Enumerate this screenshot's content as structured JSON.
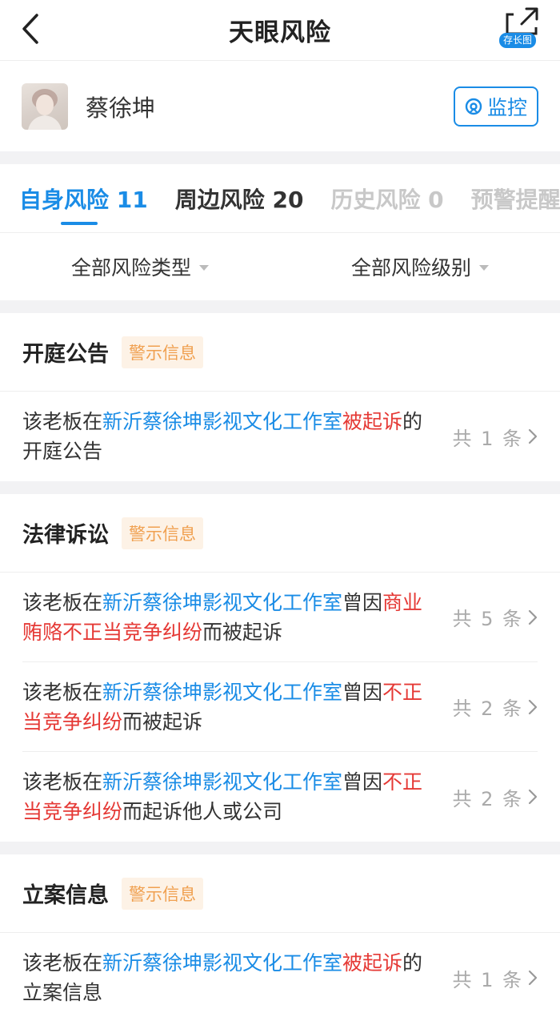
{
  "header": {
    "title": "天眼风险",
    "share_badge": "存长图"
  },
  "boss": {
    "name": "蔡徐坤",
    "monitor_label": "监控"
  },
  "tabs": [
    {
      "label": "自身风险 11"
    },
    {
      "label": "周边风险 20"
    },
    {
      "label": "历史风险 0"
    },
    {
      "label": "预警提醒"
    }
  ],
  "filters": {
    "type_label": "全部风险类型",
    "level_label": "全部风险级别"
  },
  "sections": [
    {
      "title": "开庭公告",
      "tag": "警示信息",
      "rows": [
        {
          "prefix": "该老板在",
          "company": "新沂蔡徐坤影视文化工作室",
          "mid": "",
          "highlight": "被起诉",
          "suffix": "的开庭公告",
          "count": "共 1 条"
        }
      ]
    },
    {
      "title": "法律诉讼",
      "tag": "警示信息",
      "rows": [
        {
          "prefix": "该老板在",
          "company": "新沂蔡徐坤影视文化工作室",
          "mid": "曾因",
          "highlight": "商业贿赂不正当竞争纠纷",
          "suffix": "而被起诉",
          "count": "共 5 条"
        },
        {
          "prefix": "该老板在",
          "company": "新沂蔡徐坤影视文化工作室",
          "mid": "曾因",
          "highlight": "不正当竞争纠纷",
          "suffix": "而被起诉",
          "count": "共 2 条"
        },
        {
          "prefix": "该老板在",
          "company": "新沂蔡徐坤影视文化工作室",
          "mid": "曾因",
          "highlight": "不正当竞争纠纷",
          "suffix": "而起诉他人或公司",
          "count": "共 2 条"
        }
      ]
    },
    {
      "title": "立案信息",
      "tag": "警示信息",
      "rows": [
        {
          "prefix": "该老板在",
          "company": "新沂蔡徐坤影视文化工作室",
          "mid": "",
          "highlight": "被起诉",
          "suffix": "的立案信息",
          "count": "共 1 条"
        }
      ]
    }
  ],
  "colors": {
    "accent": "#1a8ce6",
    "danger": "#e53935",
    "warning": "#f0a050"
  }
}
